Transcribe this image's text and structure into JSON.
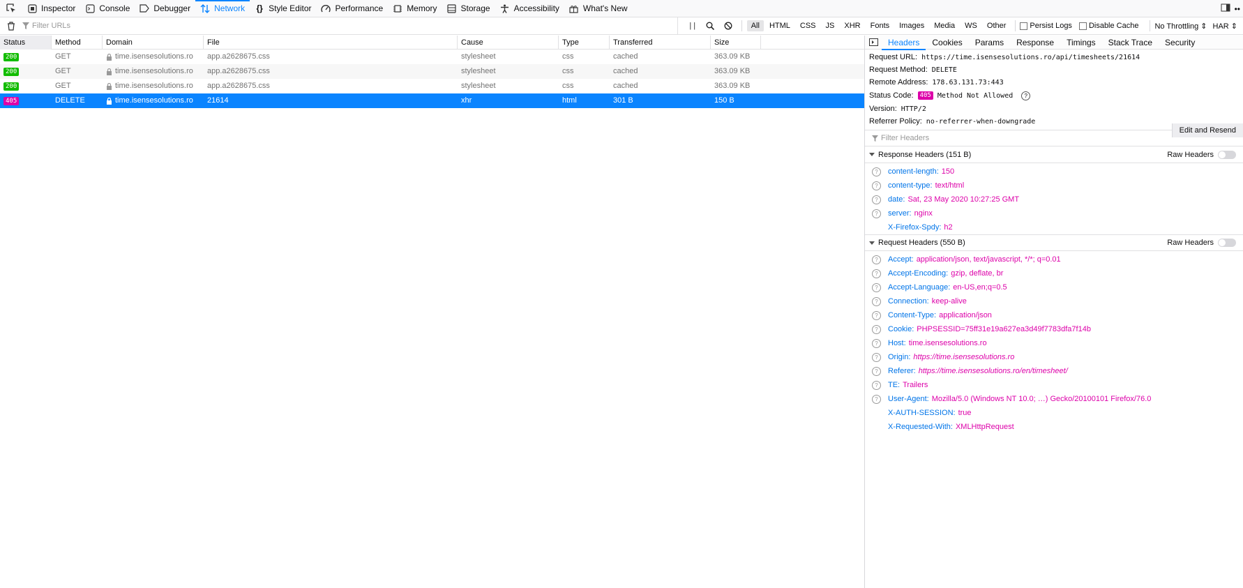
{
  "tools": [
    {
      "label": "Inspector",
      "icon": "inspector-icon"
    },
    {
      "label": "Console",
      "icon": "console-icon"
    },
    {
      "label": "Debugger",
      "icon": "debugger-icon"
    },
    {
      "label": "Network",
      "icon": "network-icon"
    },
    {
      "label": "Style Editor",
      "icon": "style-editor-icon"
    },
    {
      "label": "Performance",
      "icon": "performance-icon"
    },
    {
      "label": "Memory",
      "icon": "memory-icon"
    },
    {
      "label": "Storage",
      "icon": "storage-icon"
    },
    {
      "label": "Accessibility",
      "icon": "accessibility-icon"
    },
    {
      "label": "What's New",
      "icon": "whats-new-icon"
    }
  ],
  "filter": {
    "placeholder": "Filter URLs",
    "pause_glyph": "| |",
    "types": [
      "All",
      "HTML",
      "CSS",
      "JS",
      "XHR",
      "Fonts",
      "Images",
      "Media",
      "WS",
      "Other"
    ],
    "persist_logs": "Persist Logs",
    "disable_cache": "Disable Cache",
    "throttling": "No Throttling ⇕",
    "har": "HAR ⇕"
  },
  "table": {
    "columns": [
      "Status",
      "Method",
      "Domain",
      "File",
      "Cause",
      "Type",
      "Transferred",
      "Size"
    ],
    "rows": [
      {
        "status": "200",
        "method": "GET",
        "domain": "time.isensesolutions.ro",
        "file": "app.a2628675.css",
        "cause": "stylesheet",
        "type": "css",
        "transferred": "cached",
        "size": "363.09 KB"
      },
      {
        "status": "200",
        "method": "GET",
        "domain": "time.isensesolutions.ro",
        "file": "app.a2628675.css",
        "cause": "stylesheet",
        "type": "css",
        "transferred": "cached",
        "size": "363.09 KB"
      },
      {
        "status": "200",
        "method": "GET",
        "domain": "time.isensesolutions.ro",
        "file": "app.a2628675.css",
        "cause": "stylesheet",
        "type": "css",
        "transferred": "cached",
        "size": "363.09 KB"
      },
      {
        "status": "405",
        "method": "DELETE",
        "domain": "time.isensesolutions.ro",
        "file": "21614",
        "cause": "xhr",
        "type": "html",
        "transferred": "301 B",
        "size": "150 B"
      }
    ],
    "status_colors": {
      "200": "#12bc00",
      "405": "#d70022"
    }
  },
  "details": {
    "tabs": [
      "Headers",
      "Cookies",
      "Params",
      "Response",
      "Timings",
      "Stack Trace",
      "Security"
    ],
    "summary": {
      "request_url_label": "Request URL:",
      "request_url": "https://time.isensesolutions.ro/api/timesheets/21614",
      "method_label": "Request Method:",
      "method": "DELETE",
      "remote_label": "Remote Address:",
      "remote": "178.63.131.73:443",
      "status_label": "Status Code:",
      "status_code": "405",
      "status_text": "Method Not Allowed",
      "version_label": "Version:",
      "version": "HTTP/2",
      "referrer_label": "Referrer Policy:",
      "referrer": "no-referrer-when-downgrade"
    },
    "edit_resend": "Edit and Resend",
    "filter_headers": "Filter Headers",
    "raw_headers": "Raw Headers",
    "response_title": "Response Headers (151 B)",
    "response_headers": [
      {
        "name": "content-length:",
        "value": "150",
        "help": true
      },
      {
        "name": "content-type:",
        "value": "text/html",
        "help": true
      },
      {
        "name": "date:",
        "value": "Sat, 23 May 2020 10:27:25 GMT",
        "help": true
      },
      {
        "name": "server:",
        "value": "nginx",
        "help": true
      },
      {
        "name": "X-Firefox-Spdy:",
        "value": "h2",
        "help": false
      }
    ],
    "request_title": "Request Headers (550 B)",
    "request_headers": [
      {
        "name": "Accept:",
        "value": "application/json, text/javascript, */*; q=0.01",
        "help": true
      },
      {
        "name": "Accept-Encoding:",
        "value": "gzip, deflate, br",
        "help": true
      },
      {
        "name": "Accept-Language:",
        "value": "en-US,en;q=0.5",
        "help": true
      },
      {
        "name": "Connection:",
        "value": "keep-alive",
        "help": true
      },
      {
        "name": "Content-Type:",
        "value": "application/json",
        "help": true
      },
      {
        "name": "Cookie:",
        "value": "PHPSESSID=75ff31e19a627ea3d49f7783dfa7f14b",
        "help": true
      },
      {
        "name": "Host:",
        "value": "time.isensesolutions.ro",
        "help": true
      },
      {
        "name": "Origin:",
        "value": "https://time.isensesolutions.ro",
        "help": true,
        "italic": true
      },
      {
        "name": "Referer:",
        "value": "https://time.isensesolutions.ro/en/timesheet/",
        "help": true,
        "italic": true
      },
      {
        "name": "TE:",
        "value": "Trailers",
        "help": true
      },
      {
        "name": "User-Agent:",
        "value": "Mozilla/5.0 (Windows NT 10.0; …) Gecko/20100101 Firefox/76.0",
        "help": true
      },
      {
        "name": "X-AUTH-SESSION:",
        "value": "true",
        "help": false
      },
      {
        "name": "X-Requested-With:",
        "value": "XMLHttpRequest",
        "help": false
      }
    ]
  }
}
